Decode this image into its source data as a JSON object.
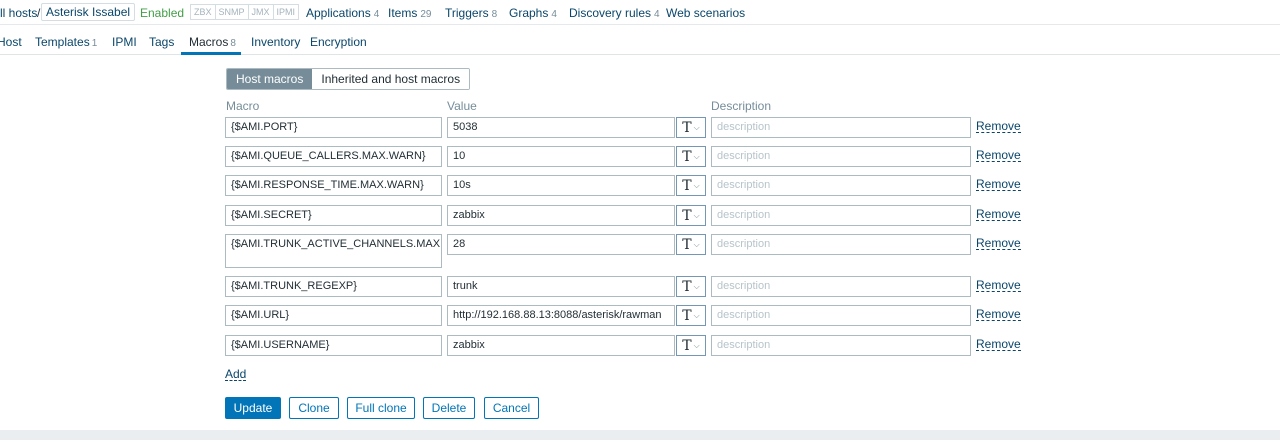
{
  "breadcrumb": {
    "all_hosts": "ll hosts",
    "separator": "/",
    "host_name": "Asterisk Issabel",
    "status": "Enabled",
    "availability": [
      "ZBX",
      "SNMP",
      "JMX",
      "IPMI"
    ],
    "links": [
      {
        "label": "Applications",
        "count": "4"
      },
      {
        "label": "Items",
        "count": "29"
      },
      {
        "label": "Triggers",
        "count": "8"
      },
      {
        "label": "Graphs",
        "count": "4"
      },
      {
        "label": "Discovery rules",
        "count": "4"
      },
      {
        "label": "Web scenarios",
        "count": ""
      }
    ]
  },
  "tabs": [
    {
      "label": "Host",
      "count": ""
    },
    {
      "label": "Templates",
      "count": "1"
    },
    {
      "label": "IPMI",
      "count": ""
    },
    {
      "label": "Tags",
      "count": ""
    },
    {
      "label": "Macros",
      "count": "8",
      "active": true
    },
    {
      "label": "Inventory",
      "count": ""
    },
    {
      "label": "Encryption",
      "count": ""
    }
  ],
  "macro_view": {
    "options": [
      "Host macros",
      "Inherited and host macros"
    ],
    "selected": "Host macros"
  },
  "columns": {
    "macro": "Macro",
    "value": "Value",
    "description": "Description"
  },
  "macros": [
    {
      "macro": "{$AMI.PORT}",
      "value": "5038",
      "description_placeholder": "description",
      "remove": "Remove"
    },
    {
      "macro": "{$AMI.QUEUE_CALLERS.MAX.WARN}",
      "value": "10",
      "description_placeholder": "description",
      "remove": "Remove"
    },
    {
      "macro": "{$AMI.RESPONSE_TIME.MAX.WARN}",
      "value": "10s",
      "description_placeholder": "description",
      "remove": "Remove"
    },
    {
      "macro": "{$AMI.SECRET}",
      "value": "zabbix",
      "description_placeholder": "description",
      "remove": "Remove"
    },
    {
      "macro": "{$AMI.TRUNK_ACTIVE_CHANNELS.MAX.WARN}",
      "value": "28",
      "description_placeholder": "description",
      "remove": "Remove"
    },
    {
      "macro": "{$AMI.TRUNK_REGEXP}",
      "value": "trunk",
      "description_placeholder": "description",
      "remove": "Remove"
    },
    {
      "macro": "{$AMI.URL}",
      "value": "http://192.168.88.13:8088/asterisk/rawman",
      "description_placeholder": "description",
      "remove": "Remove"
    },
    {
      "macro": "{$AMI.USERNAME}",
      "value": "zabbix",
      "description_placeholder": "description",
      "remove": "Remove"
    }
  ],
  "value_type_icon": "text-type-icon",
  "value_type_glyph": "T",
  "add_label": "Add",
  "buttons": {
    "update": "Update",
    "clone": "Clone",
    "full_clone": "Full clone",
    "delete": "Delete",
    "cancel": "Cancel"
  },
  "colors": {
    "link": "#0a466a",
    "enabled": "#429e47",
    "primary": "#0275b8",
    "segment_active": "#768d99"
  }
}
